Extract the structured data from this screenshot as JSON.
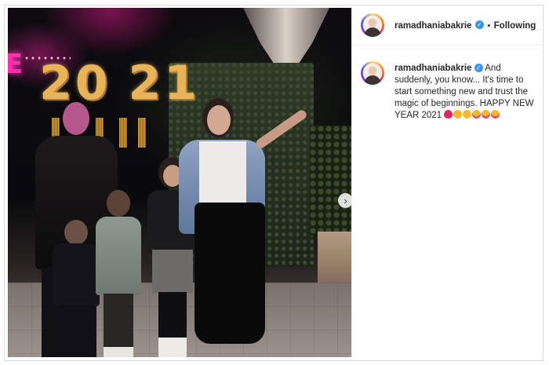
{
  "post": {
    "username": "ramadhaniabakrie",
    "verified_mark": "✓",
    "separator": "•",
    "follow_status": "Following",
    "caption": {
      "username": "ramadhaniabakrie",
      "text": "And suddenly, you know... It's time to start something new and trust the magic of beginnings. HAPPY NEW YEAR 2021",
      "emojis": [
        "red-heart",
        "clapping-hands",
        "clapping-hands",
        "party-face",
        "party-face",
        "party-face"
      ]
    }
  },
  "photo": {
    "balloon_text": [
      "2",
      "0",
      "2",
      "1"
    ],
    "neon_letter": "E",
    "next_icon": "›"
  },
  "colors": {
    "verified": "#3897f0",
    "text": "#262626",
    "heart": "#e0245e",
    "emoji": "#f5b82e"
  }
}
